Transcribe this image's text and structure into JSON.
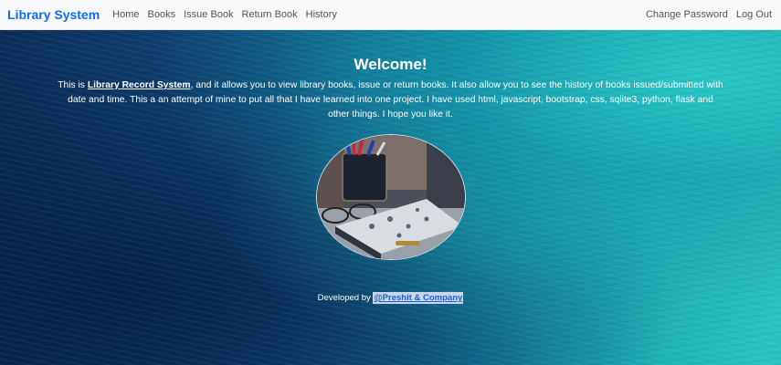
{
  "navbar": {
    "brand": "Library System",
    "left_links": [
      "Home",
      "Books",
      "Issue Book",
      "Return Book",
      "History"
    ],
    "right_links": [
      "Change Password",
      "Log Out"
    ]
  },
  "main": {
    "heading": "Welcome!",
    "intro_prefix": "This is ",
    "intro_highlight": "Library Record System",
    "intro_suffix": ", and it allows you to view library books, issue or return books. It also allow you to see the history of books issued/submitted with date and time. This a an attempt of mine to put all that I have learned into one project. I have used html, javascript, bootstrap, css, sqlite3, python, flask and other things. I hope you like it."
  },
  "footer": {
    "prefix": "Developed by ",
    "credit": "@Preshit & Company"
  },
  "colors": {
    "brand": "#0d6efd",
    "navbar_bg": "#f8f9fa",
    "ocean_dark": "#0a2d5a",
    "ocean_teal": "#2cc4c0"
  }
}
